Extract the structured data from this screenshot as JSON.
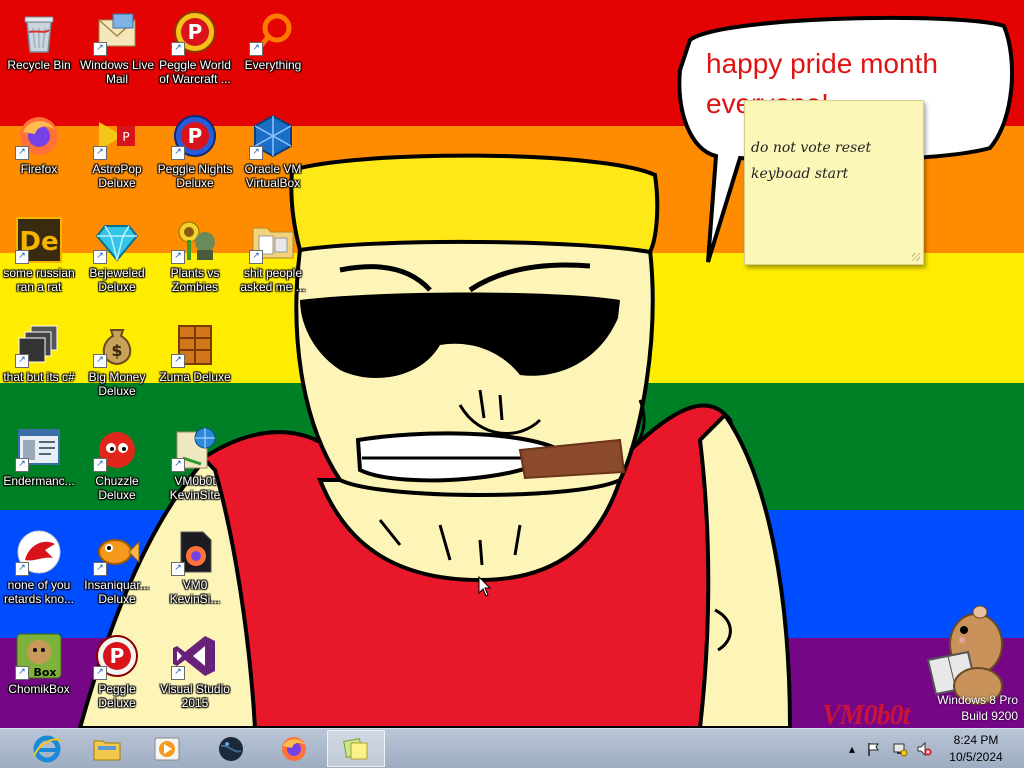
{
  "wallpaper": {
    "stripes": [
      "#e40303",
      "#ff8c00",
      "#ffed00",
      "#008026",
      "#004dff",
      "#750787"
    ],
    "bubble_line1": "happy pride month",
    "bubble_line2": "everyone!"
  },
  "sticky_note": {
    "lines": [
      "do not vote reset",
      "keyboad start"
    ]
  },
  "desktop_icons": [
    {
      "label": "Recycle Bin",
      "icon": "recycle-bin-icon"
    },
    {
      "label": "Windows Live Mail",
      "icon": "mail-icon"
    },
    {
      "label": "Peggle World of Warcraft ...",
      "icon": "peggle-icon"
    },
    {
      "label": "Everything",
      "icon": "search-ring-icon"
    },
    {
      "label": "Firefox",
      "icon": "firefox-icon"
    },
    {
      "label": "AstroPop Deluxe",
      "icon": "astropop-icon"
    },
    {
      "label": "Peggle Nights Deluxe",
      "icon": "peggle-nights-icon"
    },
    {
      "label": "Oracle VM VirtualBox",
      "icon": "virtualbox-icon"
    },
    {
      "label": "some russian ran a rat",
      "icon": "de-icon"
    },
    {
      "label": "Bejeweled Deluxe",
      "icon": "gem-icon"
    },
    {
      "label": "Plants vs Zombies",
      "icon": "plant-icon"
    },
    {
      "label": "shit people asked me ...",
      "icon": "folder-icon"
    },
    {
      "label": "that but its c#",
      "icon": "windows-stack-icon"
    },
    {
      "label": "Big Money Deluxe",
      "icon": "money-bag-icon"
    },
    {
      "label": "Zuma Deluxe",
      "icon": "zuma-icon"
    },
    {
      "label": "Endermanc...",
      "icon": "app-window-icon"
    },
    {
      "label": "Chuzzle Deluxe",
      "icon": "chuzzle-icon"
    },
    {
      "label": "VM0b0t KevinSite",
      "icon": "web-globe-icon"
    },
    {
      "label": "none of you retards kno...",
      "icon": "red-dragon-icon"
    },
    {
      "label": "Insaniquar... Deluxe",
      "icon": "fish-icon"
    },
    {
      "label": "VM0 KevinSi...",
      "icon": "firefox-doc-icon"
    },
    {
      "label": "ChomikBox",
      "icon": "chomikbox-icon"
    },
    {
      "label": "Peggle Deluxe",
      "icon": "peggle-deluxe-icon"
    },
    {
      "label": "Visual Studio 2015",
      "icon": "visual-studio-icon"
    }
  ],
  "watermark": {
    "signature": "VM0b0t",
    "line1": "Windows 8 Pro",
    "line2": "Build 9200"
  },
  "taskbar": {
    "apps": [
      {
        "name": "internet-explorer",
        "active": false
      },
      {
        "name": "file-explorer",
        "active": false
      },
      {
        "name": "media-player",
        "active": false
      },
      {
        "name": "dark-globe",
        "active": false
      },
      {
        "name": "firefox",
        "active": false
      },
      {
        "name": "sticky-notes",
        "active": true
      }
    ],
    "tray_icons": [
      "show-hidden-icons-chevron",
      "action-center-flag",
      "network-icon",
      "volume-muted-icon"
    ],
    "time": "8:24 PM",
    "date": "10/5/2024"
  }
}
